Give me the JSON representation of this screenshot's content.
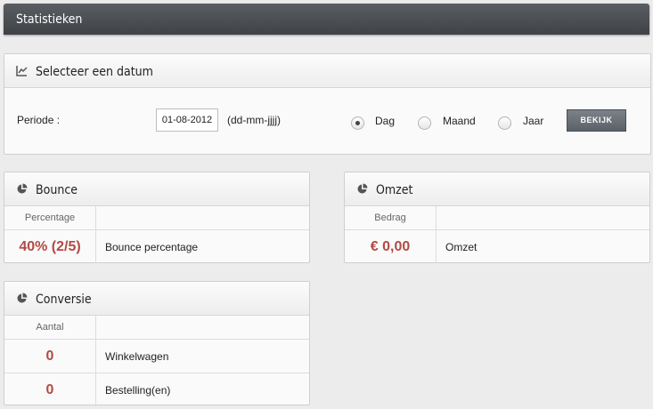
{
  "page_title": "Statistieken",
  "date_panel": {
    "title": "Selecteer een datum",
    "period_label": "Periode :",
    "date_value": "01-08-2012",
    "date_format_hint": "(dd-mm-jjjj)",
    "options": [
      {
        "label": "Dag",
        "selected": true
      },
      {
        "label": "Maand",
        "selected": false
      },
      {
        "label": "Jaar",
        "selected": false
      }
    ],
    "submit_label": "BEKIJK"
  },
  "bounce": {
    "title": "Bounce",
    "col_header": "Percentage",
    "rows": [
      {
        "value": "40% (2/5)",
        "label": "Bounce percentage"
      }
    ]
  },
  "omzet": {
    "title": "Omzet",
    "col_header": "Bedrag",
    "rows": [
      {
        "value": "€ 0,00",
        "label": "Omzet"
      }
    ]
  },
  "conversie": {
    "title": "Conversie",
    "col_header": "Aantal",
    "rows": [
      {
        "value": "0",
        "label": "Winkelwagen"
      },
      {
        "value": "0",
        "label": "Bestelling(en)"
      }
    ]
  },
  "colors": {
    "accent_value": "#b24a44",
    "topbar": "#4a4d52"
  }
}
